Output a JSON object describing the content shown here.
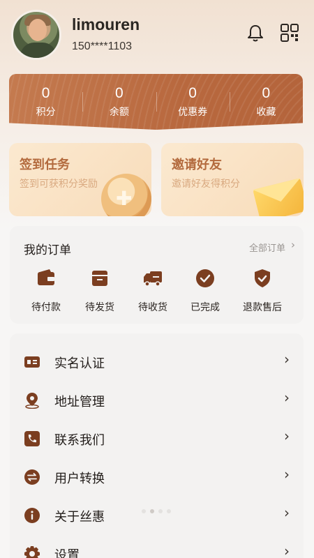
{
  "profile": {
    "username": "limouren",
    "phone": "150****1103"
  },
  "header_icons": [
    "bell-icon",
    "qr-code-icon"
  ],
  "stats": [
    {
      "value": "0",
      "label": "积分"
    },
    {
      "value": "0",
      "label": "余额"
    },
    {
      "value": "0",
      "label": "优惠券"
    },
    {
      "value": "0",
      "label": "收藏"
    }
  ],
  "promos": {
    "checkin": {
      "title": "签到任务",
      "subtitle": "签到可获积分奖励"
    },
    "invite": {
      "title": "邀请好友",
      "subtitle": "邀请好友得积分"
    }
  },
  "orders": {
    "title": "我的订单",
    "all_label": "全部订单",
    "items": [
      {
        "label": "待付款",
        "icon": "wallet-icon"
      },
      {
        "label": "待发货",
        "icon": "box-icon"
      },
      {
        "label": "待收货",
        "icon": "truck-icon"
      },
      {
        "label": "已完成",
        "icon": "check-circle-icon"
      },
      {
        "label": "退款售后",
        "icon": "shield-check-icon"
      }
    ]
  },
  "menu": [
    {
      "label": "实名认证",
      "icon": "id-card-icon"
    },
    {
      "label": "地址管理",
      "icon": "location-icon"
    },
    {
      "label": "联系我们",
      "icon": "phone-icon"
    },
    {
      "label": "用户转换",
      "icon": "swap-icon"
    },
    {
      "label": "关于丝惠",
      "icon": "info-icon"
    },
    {
      "label": "设置",
      "icon": "gear-icon"
    }
  ],
  "colors": {
    "accent": "#7b3e20",
    "stats_bg": "#bd6f45",
    "promo_title": "#b36a3d"
  }
}
